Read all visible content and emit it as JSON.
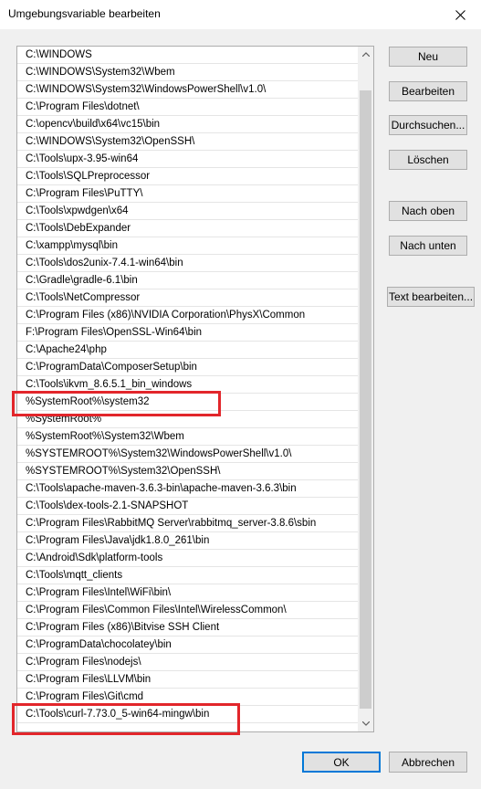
{
  "window": {
    "title": "Umgebungsvariable bearbeiten",
    "close_icon": "close-icon"
  },
  "paths": [
    "C:\\WINDOWS",
    "C:\\WINDOWS\\System32\\Wbem",
    "C:\\WINDOWS\\System32\\WindowsPowerShell\\v1.0\\",
    "C:\\Program Files\\dotnet\\",
    "C:\\opencv\\build\\x64\\vc15\\bin",
    "C:\\WINDOWS\\System32\\OpenSSH\\",
    "C:\\Tools\\upx-3.95-win64",
    "C:\\Tools\\SQLPreprocessor",
    "C:\\Program Files\\PuTTY\\",
    "C:\\Tools\\xpwdgen\\x64",
    "C:\\Tools\\DebExpander",
    "C:\\xampp\\mysql\\bin",
    "C:\\Tools\\dos2unix-7.4.1-win64\\bin",
    "C:\\Gradle\\gradle-6.1\\bin",
    "C:\\Tools\\NetCompressor",
    "C:\\Program Files (x86)\\NVIDIA Corporation\\PhysX\\Common",
    "F:\\Program Files\\OpenSSL-Win64\\bin",
    "C:\\Apache24\\php",
    "C:\\ProgramData\\ComposerSetup\\bin",
    "C:\\Tools\\ikvm_8.6.5.1_bin_windows",
    "%SystemRoot%\\system32",
    "%SystemRoot%",
    "%SystemRoot%\\System32\\Wbem",
    "%SYSTEMROOT%\\System32\\WindowsPowerShell\\v1.0\\",
    "%SYSTEMROOT%\\System32\\OpenSSH\\",
    "C:\\Tools\\apache-maven-3.6.3-bin\\apache-maven-3.6.3\\bin",
    "C:\\Tools\\dex-tools-2.1-SNAPSHOT",
    "C:\\Program Files\\RabbitMQ Server\\rabbitmq_server-3.8.6\\sbin",
    "C:\\Program Files\\Java\\jdk1.8.0_261\\bin",
    "C:\\Android\\Sdk\\platform-tools",
    "C:\\Tools\\mqtt_clients",
    "C:\\Program Files\\Intel\\WiFi\\bin\\",
    "C:\\Program Files\\Common Files\\Intel\\WirelessCommon\\",
    "C:\\Program Files (x86)\\Bitvise SSH Client",
    "C:\\ProgramData\\chocolatey\\bin",
    "C:\\Program Files\\nodejs\\",
    "C:\\Program Files\\LLVM\\bin",
    "C:\\Program Files\\Git\\cmd",
    "C:\\Tools\\curl-7.73.0_5-win64-mingw\\bin"
  ],
  "buttons": {
    "new": "Neu",
    "edit": "Bearbeiten",
    "browse": "Durchsuchen...",
    "delete": "Löschen",
    "move_up": "Nach oben",
    "move_down": "Nach unten",
    "edit_text": "Text bearbeiten...",
    "ok": "OK",
    "cancel": "Abbrechen"
  },
  "highlight_color": "#e2262b"
}
